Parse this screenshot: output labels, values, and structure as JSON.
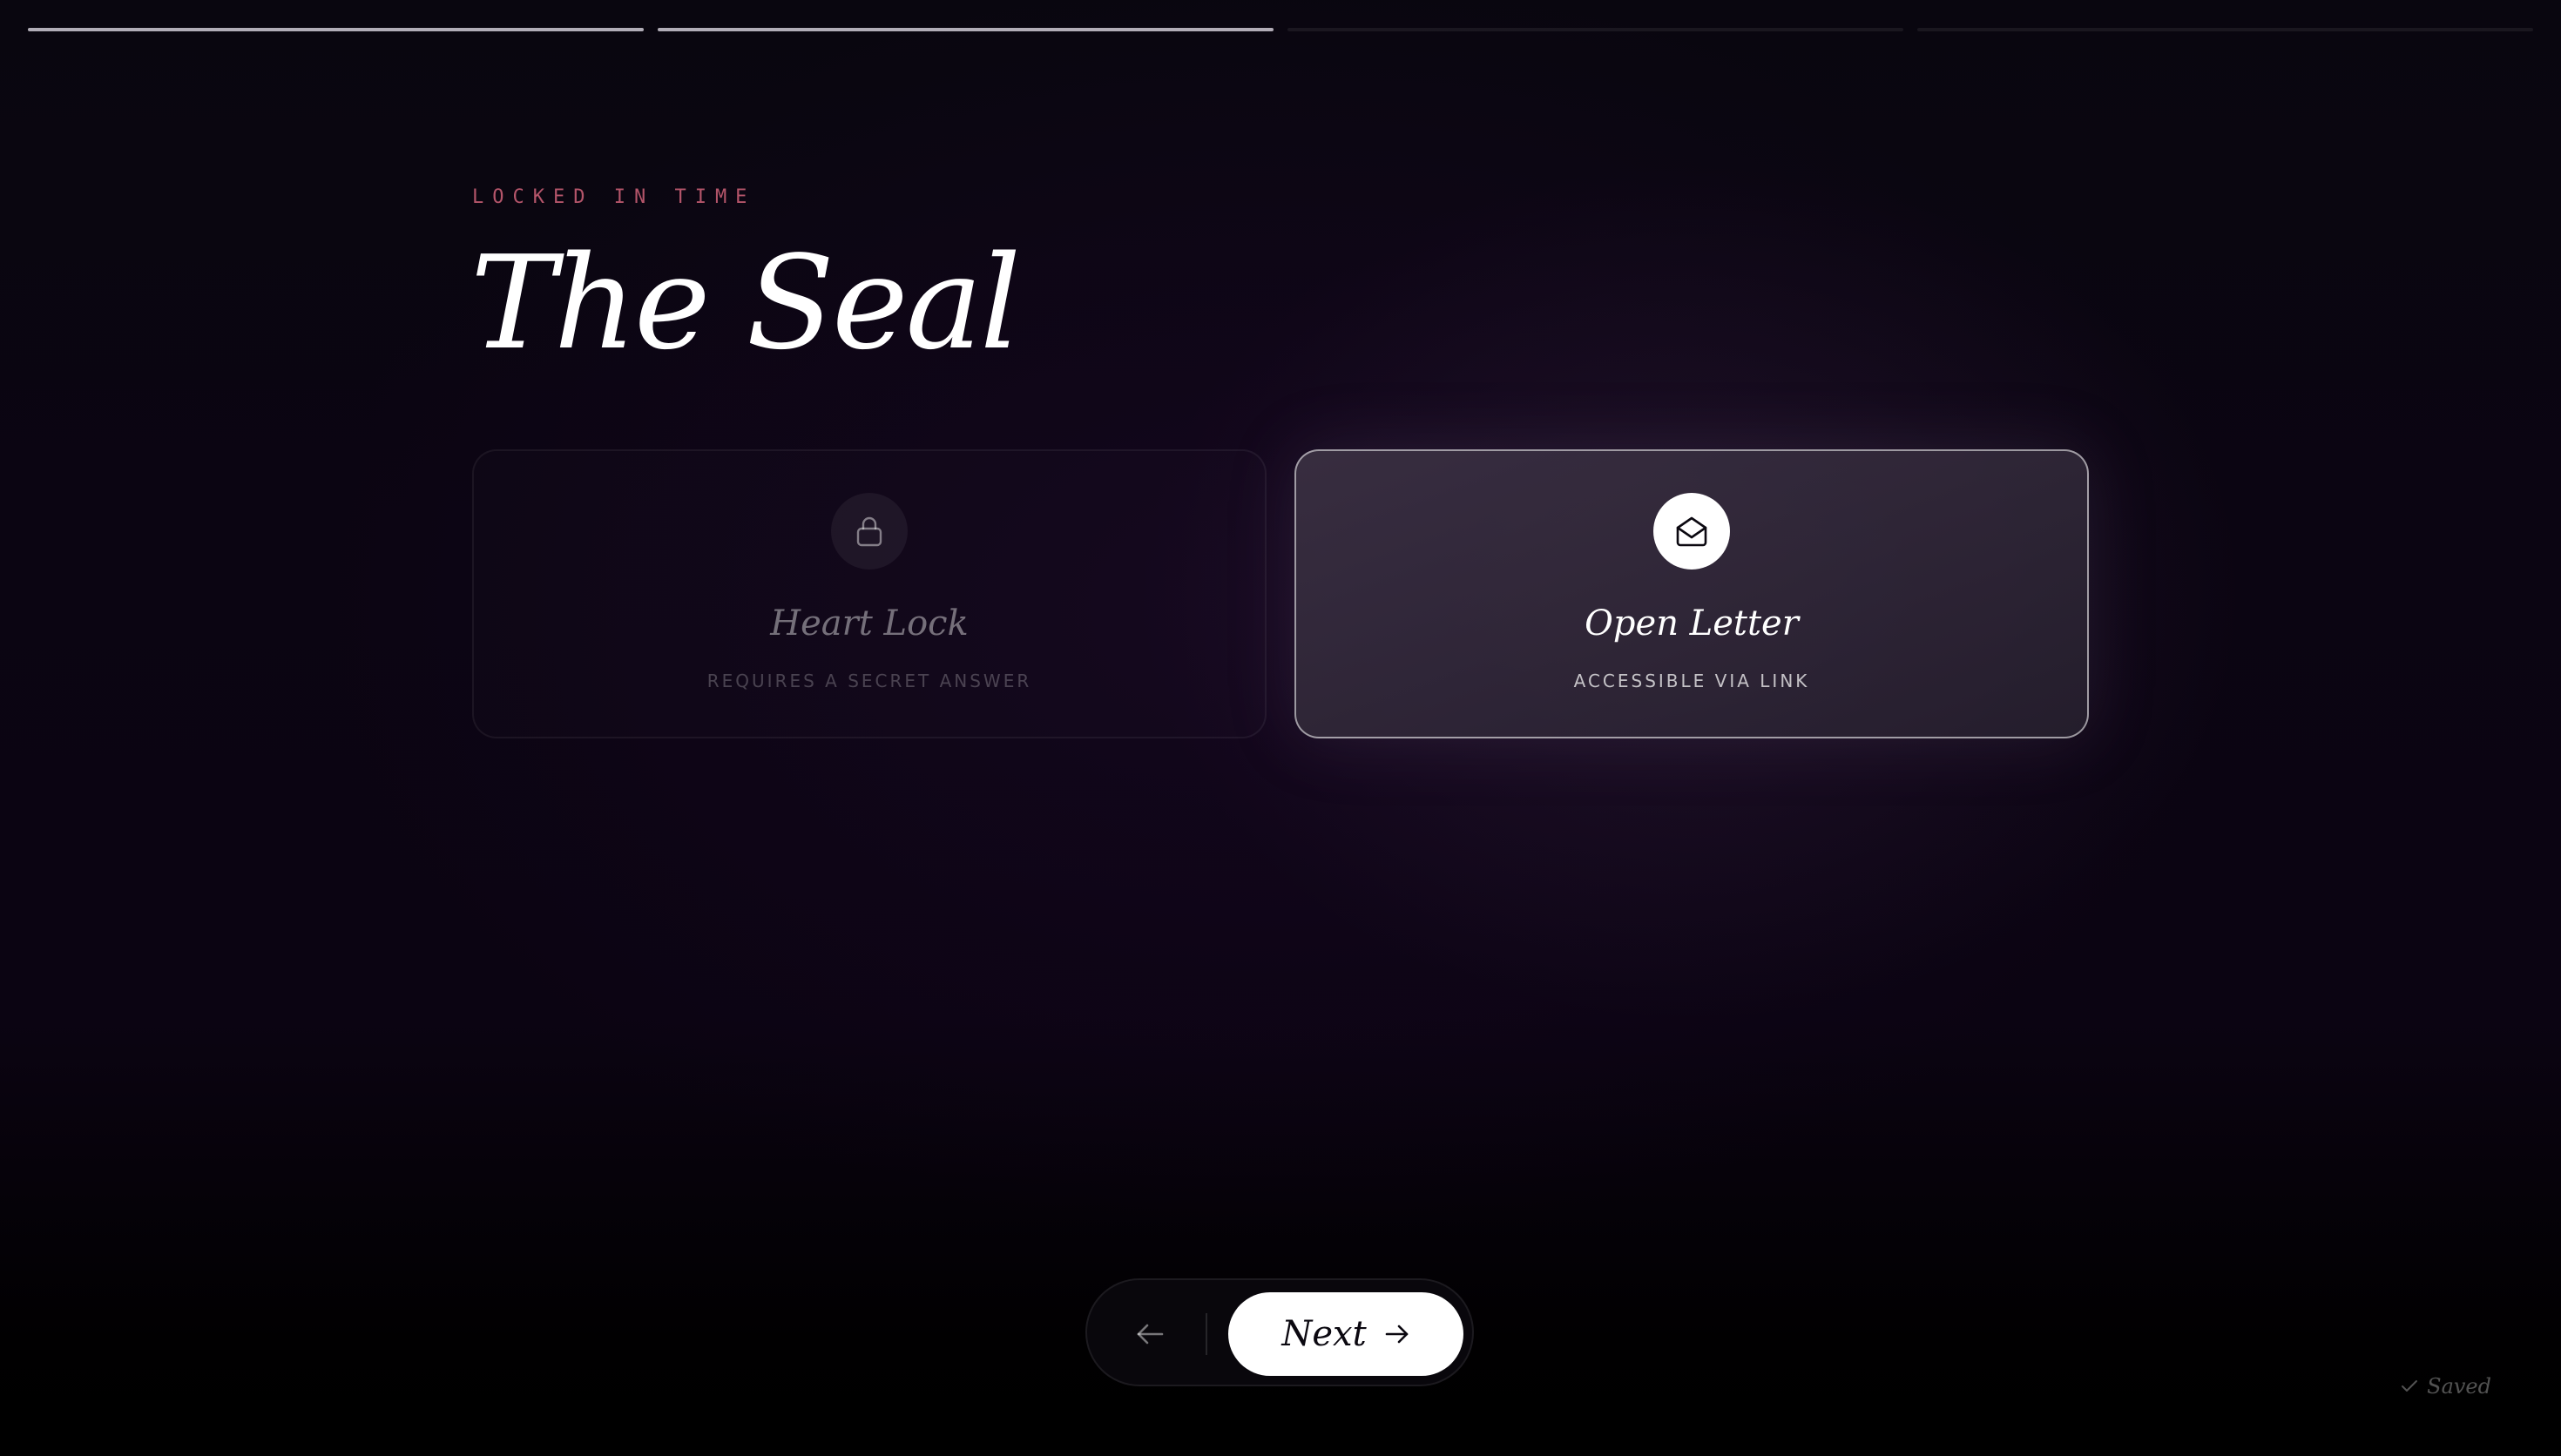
{
  "progress": {
    "total_steps": 4,
    "completed_steps": 2
  },
  "header": {
    "eyebrow": "LOCKED IN TIME",
    "title": "The Seal"
  },
  "options": [
    {
      "id": "heart-lock",
      "title": "Heart Lock",
      "subtitle": "REQUIRES A SECRET ANSWER",
      "icon": "lock-icon",
      "selected": false
    },
    {
      "id": "open-letter",
      "title": "Open Letter",
      "subtitle": "ACCESSIBLE VIA LINK",
      "icon": "envelope-open-icon",
      "selected": true
    }
  ],
  "nav": {
    "back_icon": "arrow-left-icon",
    "next_label": "Next",
    "next_icon": "arrow-right-icon"
  },
  "status": {
    "saved_label": "Saved",
    "saved_icon": "check-icon"
  },
  "colors": {
    "accent": "#b4556a",
    "background": "#0b0512",
    "selected_card": "#3a3142"
  }
}
